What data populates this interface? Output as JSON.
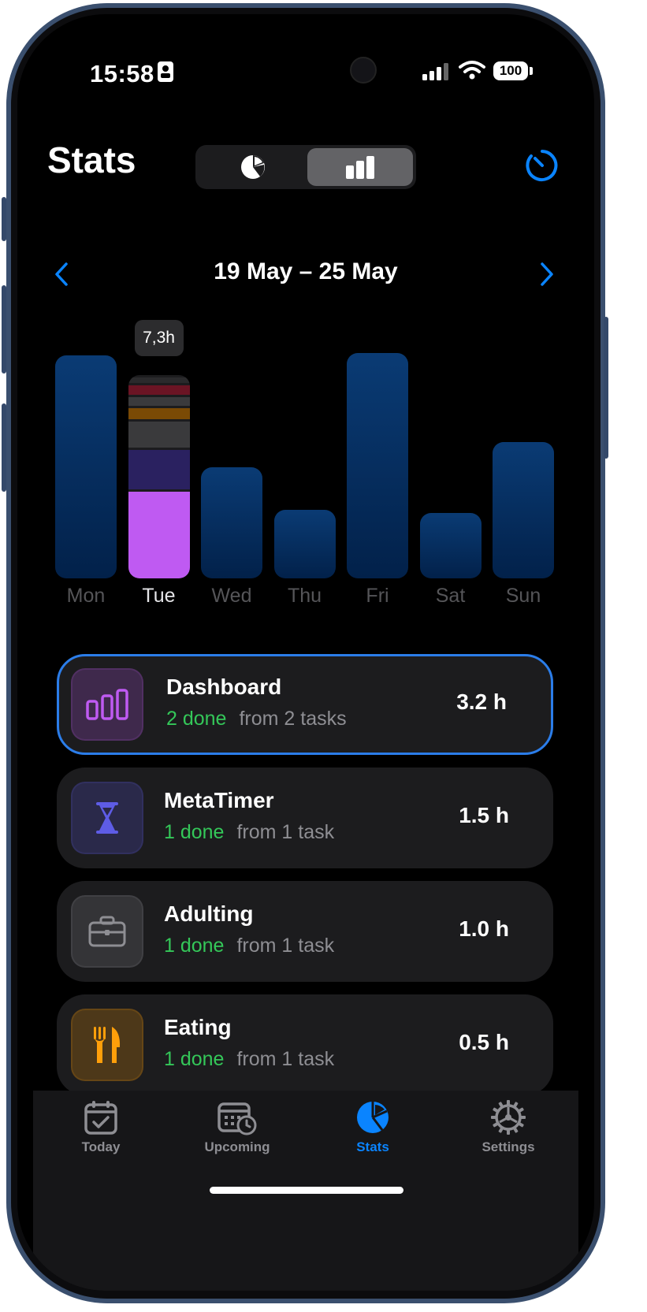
{
  "status_bar": {
    "time": "15:58",
    "battery": "100"
  },
  "header": {
    "title": "Stats"
  },
  "week_nav": {
    "label": "19 May – 25 May"
  },
  "chart_data": {
    "type": "bar",
    "categories": [
      "Mon",
      "Tue",
      "Wed",
      "Thu",
      "Fri",
      "Sat",
      "Sun"
    ],
    "values": [
      8.0,
      7.3,
      4.0,
      2.45,
      8.1,
      2.35,
      4.9
    ],
    "selected_index": 1,
    "tooltip": "7,3h",
    "selected_breakdown": [
      {
        "color": "#bf5af2",
        "value": 3.2
      },
      {
        "color": "#2a2160",
        "value": 1.5
      },
      {
        "color": "#3a3a3c",
        "value": 1.0
      },
      {
        "color": "#7a4a05",
        "value": 0.5
      },
      {
        "color": "#3a3a3c",
        "value": 0.4
      },
      {
        "color": "#6b1424",
        "value": 0.4
      },
      {
        "color": "#2a2a2c",
        "value": 0.3
      }
    ],
    "ylim": [
      0,
      8.2
    ]
  },
  "projects": [
    {
      "name": "Dashboard",
      "done": "2 done",
      "from": "from 2 tasks",
      "hours": "3.2 h",
      "icon": "bar-chart-icon",
      "color": "#bf5af2"
    },
    {
      "name": "MetaTimer",
      "done": "1 done",
      "from": "from 1 task",
      "hours": "1.5 h",
      "icon": "hourglass-icon",
      "color": "#5e5ce6"
    },
    {
      "name": "Adulting",
      "done": "1 done",
      "from": "from 1 task",
      "hours": "1.0 h",
      "icon": "briefcase-icon",
      "color": "#8e8e93"
    },
    {
      "name": "Eating",
      "done": "1 done",
      "from": "from 1 task",
      "hours": "0.5 h",
      "icon": "fork-knife-icon",
      "color": "#ff9f0a"
    }
  ],
  "tabs": [
    {
      "label": "Today",
      "icon": "calendar-check-icon"
    },
    {
      "label": "Upcoming",
      "icon": "calendar-clock-icon"
    },
    {
      "label": "Stats",
      "icon": "pie-chart-icon"
    },
    {
      "label": "Settings",
      "icon": "gear-icon"
    }
  ],
  "colors": {
    "accent": "#0a84ff",
    "done": "#34c759",
    "bar": "#0a3b74"
  }
}
